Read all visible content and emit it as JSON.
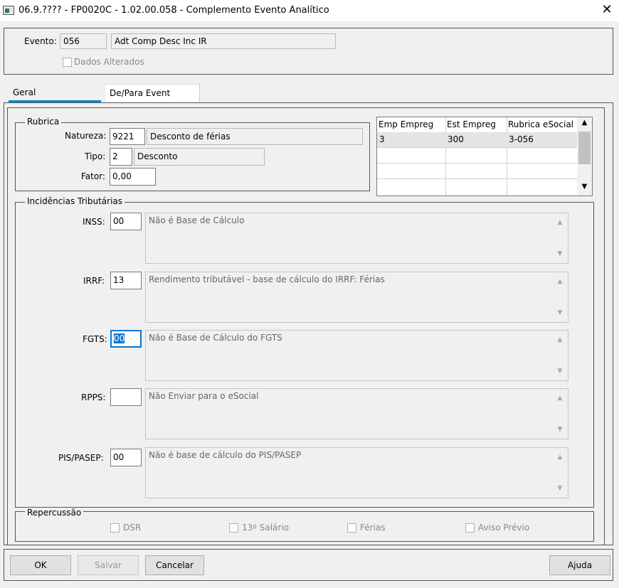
{
  "window": {
    "title": "06.9.???? - FP0020C - 1.02.00.058 - Complemento Evento Analítico",
    "close_glyph": "✕"
  },
  "header": {
    "evento_label": "Evento:",
    "evento_code": "056",
    "evento_desc": "Adt Comp Desc Inc IR",
    "dados_alterados_label": "Dados Alterados"
  },
  "tabs": [
    {
      "label": "Geral",
      "active": true
    },
    {
      "label": "De/Para Event",
      "active": false
    }
  ],
  "rubrica": {
    "group_title": "Rubrica",
    "natureza_label": "Natureza:",
    "natureza_value": "9221",
    "natureza_desc": "Desconto de férias",
    "tipo_label": "Tipo:",
    "tipo_value": "2",
    "tipo_desc": "Desconto",
    "fator_label": "Fator:",
    "fator_value": "0,00"
  },
  "grid": {
    "columns": [
      "Emp Empreg",
      "Est Empreg",
      "Rubrica eSocial"
    ],
    "rows": [
      [
        "3",
        "300",
        "3-056"
      ],
      [
        "",
        "",
        ""
      ],
      [
        "",
        "",
        ""
      ],
      [
        "",
        "",
        ""
      ]
    ]
  },
  "incidencias": {
    "group_title": "Incidências Tributárias",
    "items": [
      {
        "label": "INSS:",
        "value": "00",
        "desc": "Não é Base de Cálculo"
      },
      {
        "label": "IRRF:",
        "value": "13",
        "desc": "Rendimento tributável - base de cálculo do IRRF: Férias"
      },
      {
        "label": "FGTS:",
        "value": "00",
        "desc": "Não é Base de Cálculo do FGTS"
      },
      {
        "label": "RPPS:",
        "value": "",
        "desc": "Não Enviar para o eSocial"
      },
      {
        "label": "PIS/PASEP:",
        "value": "00",
        "desc": "Não é base de cálculo do PIS/PASEP"
      }
    ]
  },
  "repercussao": {
    "group_title": "Repercussão",
    "options": [
      "DSR",
      "13º Salário",
      "Férias",
      "Aviso Prévio"
    ]
  },
  "buttons": {
    "ok": "OK",
    "salvar": "Salvar",
    "cancelar": "Cancelar",
    "ajuda": "Ajuda"
  },
  "colors": {
    "tab_accent": "#0a84d0",
    "selection": "#0078d7"
  }
}
